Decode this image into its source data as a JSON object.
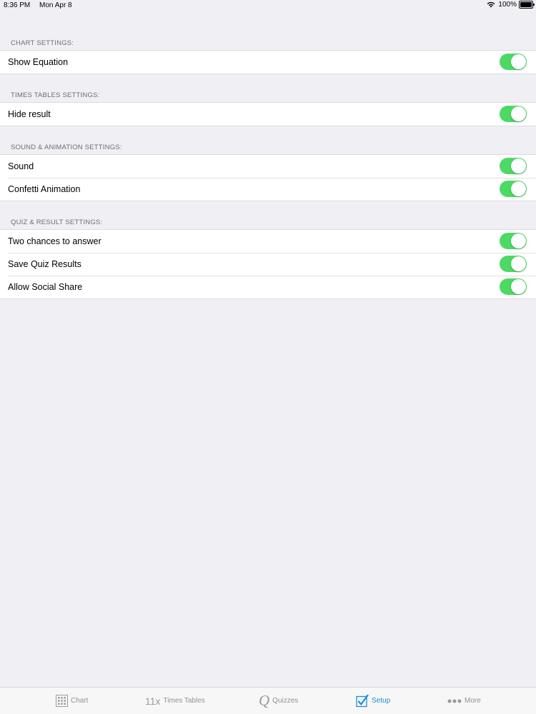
{
  "status_bar": {
    "time": "8:36 PM",
    "date": "Mon Apr 8",
    "battery": "100%"
  },
  "sections": [
    {
      "header": "CHART SETTINGS:",
      "rows": [
        {
          "label": "Show Equation",
          "on": true
        }
      ]
    },
    {
      "header": "TIMES TABLES SETTINGS:",
      "rows": [
        {
          "label": "Hide result",
          "on": true
        }
      ]
    },
    {
      "header": "SOUND & ANIMATION SETTINGS:",
      "rows": [
        {
          "label": "Sound",
          "on": true
        },
        {
          "label": "Confetti Animation",
          "on": true
        }
      ]
    },
    {
      "header": "QUIZ & RESULT SETTINGS:",
      "rows": [
        {
          "label": "Two chances to answer",
          "on": true
        },
        {
          "label": "Save Quiz Results",
          "on": true
        },
        {
          "label": "Allow Social Share",
          "on": true
        }
      ]
    }
  ],
  "tab_bar": {
    "chart": {
      "label": "Chart",
      "icon": "grid-icon"
    },
    "times_tables": {
      "label": "Times Tables",
      "icon_text": "11x"
    },
    "quizzes": {
      "label": "Quizzes",
      "icon_text": "Q"
    },
    "setup": {
      "label": "Setup",
      "icon": "checkbox-icon",
      "active": true
    },
    "more": {
      "label": "More",
      "icon": "ellipsis-icon"
    }
  },
  "colors": {
    "toggle_on": "#4cd964",
    "active_tab": "#1a8cdf",
    "inactive_tab": "#929292",
    "background": "#efeff4"
  }
}
